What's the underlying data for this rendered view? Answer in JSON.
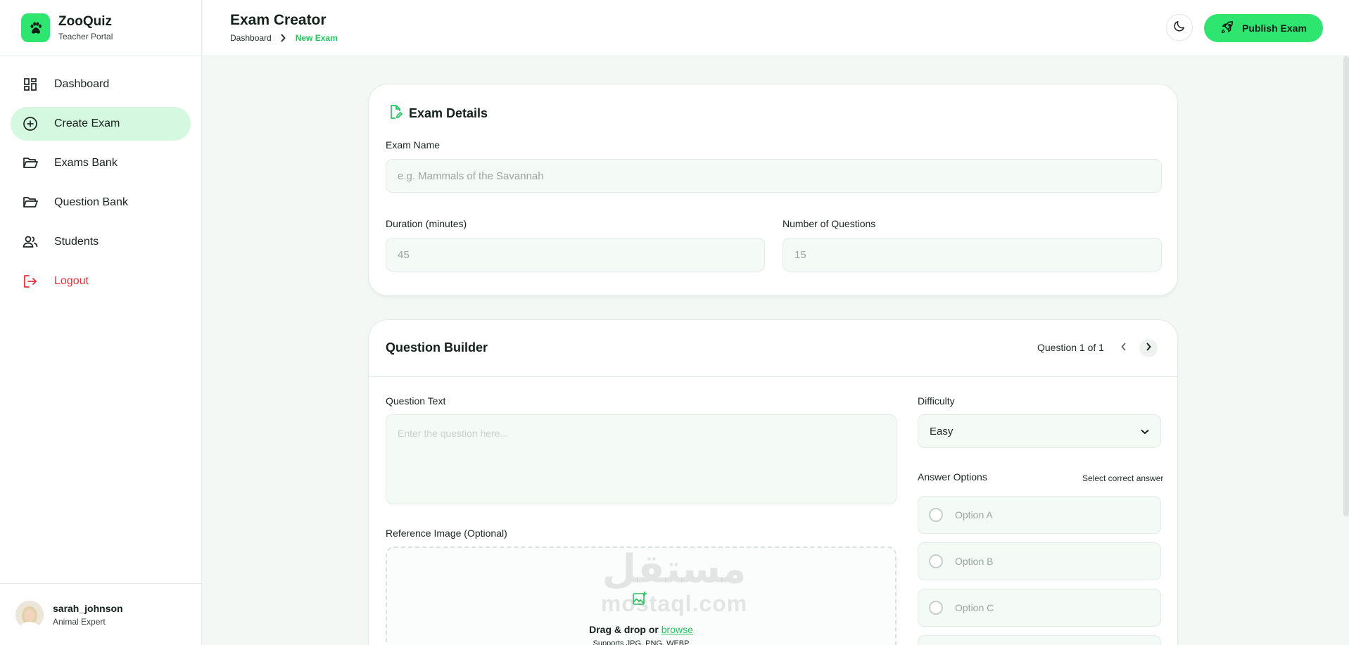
{
  "brand": {
    "name": "ZooQuiz",
    "subtitle": "Teacher Portal",
    "accent": "#2ee56f"
  },
  "sidebar": {
    "items": [
      {
        "label": "Dashboard",
        "icon": "dashboard-icon",
        "active": false
      },
      {
        "label": "Create Exam",
        "icon": "plus-circle-icon",
        "active": true
      },
      {
        "label": "Exams Bank",
        "icon": "folder-open-icon",
        "active": false
      },
      {
        "label": "Question Bank",
        "icon": "folder-open-icon",
        "active": false
      },
      {
        "label": "Students",
        "icon": "users-icon",
        "active": false
      },
      {
        "label": "Logout",
        "icon": "logout-icon",
        "active": false
      }
    ]
  },
  "user": {
    "name": "sarah_johnson",
    "role": "Animal Expert"
  },
  "header": {
    "title": "Exam Creator",
    "breadcrumb": [
      "Dashboard",
      "New Exam"
    ],
    "publish_label": "Publish Exam"
  },
  "exam_details": {
    "title": "Exam Details",
    "name_label": "Exam Name",
    "name_placeholder": "e.g. Mammals of the Savannah",
    "duration_label": "Duration (minutes)",
    "duration_placeholder": "45",
    "count_label": "Number of Questions",
    "count_placeholder": "15"
  },
  "question_builder": {
    "title": "Question Builder",
    "counter": "Question 1 of 1",
    "question_label": "Question Text",
    "question_placeholder": "Enter the question here...",
    "difficulty_label": "Difficulty",
    "difficulty_value": "Easy",
    "answers_label": "Answer Options",
    "answers_hint": "Select correct answer",
    "options": [
      "Option A",
      "Option B",
      "Option C"
    ],
    "image_label": "Reference Image (Optional)",
    "dropzone_text": "Drag & drop or ",
    "dropzone_link": "browse",
    "dropzone_sub": "Supports JPG, PNG, WEBP"
  },
  "watermark": {
    "arabic": "مستقل",
    "latin": "mostaql.com"
  }
}
